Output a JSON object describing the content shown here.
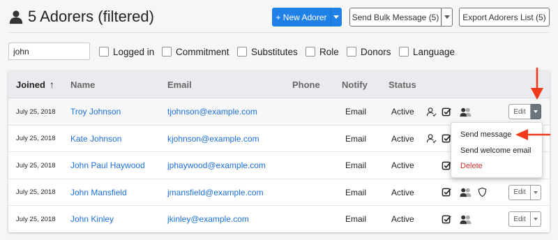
{
  "header": {
    "title": "5 Adorers (filtered)",
    "new_adorer_label": "+ New Adorer",
    "bulk_message_label": "Send Bulk Message (5)",
    "export_label": "Export Adorers List (5)"
  },
  "filters": {
    "search_value": "john",
    "checkboxes": [
      "Logged in",
      "Commitment",
      "Substitutes",
      "Role",
      "Donors",
      "Language"
    ]
  },
  "table": {
    "columns": {
      "joined": "Joined",
      "name": "Name",
      "email": "Email",
      "phone": "Phone",
      "notify": "Notify",
      "status": "Status"
    },
    "sort_indicator": "↑",
    "rows": [
      {
        "joined": "July 25, 2018",
        "name": "Troy Johnson",
        "email": "tjohnson@example.com",
        "phone": "",
        "notify": "Email",
        "status": "Active"
      },
      {
        "joined": "July 25, 2018",
        "name": "Kate Johnson",
        "email": "kjohnson@example.com",
        "phone": "",
        "notify": "Email",
        "status": "Active"
      },
      {
        "joined": "July 25, 2018",
        "name": "John Paul Haywood",
        "email": "jphaywood@example.com",
        "phone": "",
        "notify": "Email",
        "status": "Active"
      },
      {
        "joined": "July 25, 2018",
        "name": "John Mansfield",
        "email": "jmansfield@example.com",
        "phone": "",
        "notify": "Email",
        "status": "Active"
      },
      {
        "joined": "July 25, 2018",
        "name": "John Kinley",
        "email": "jkinley@example.com",
        "phone": "",
        "notify": "Email",
        "status": "Active"
      }
    ],
    "edit_label": "Edit"
  },
  "dropdown": {
    "items": [
      "Send message",
      "Send welcome email",
      "Delete"
    ]
  },
  "icons": [
    "user-icon",
    "user-check-icon",
    "check-square-icon",
    "users-icon",
    "shield-icon",
    "caret-down-icon",
    "arrow-up-icon"
  ],
  "colors": {
    "primary": "#1f80e6",
    "link": "#1d6fdc",
    "danger": "#d0312d",
    "annotation": "#f03a1c"
  }
}
